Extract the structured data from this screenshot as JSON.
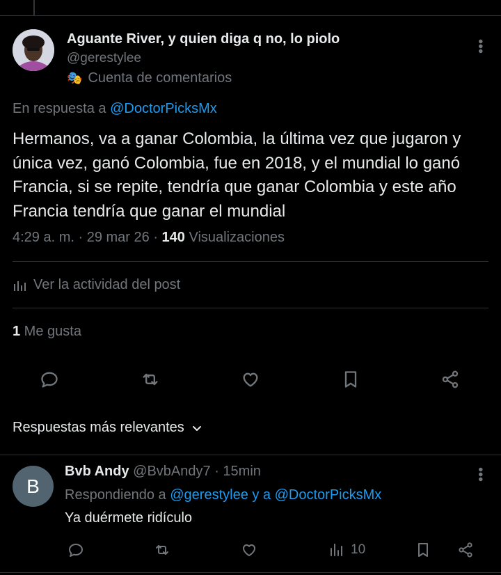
{
  "post": {
    "author_name": "Aguante River, y quien diga q no, lo piolo",
    "handle": "@gerestylee",
    "account_label": "Cuenta de comentarios",
    "account_icon": "theater-masks-icon",
    "reply_prefix": "En respuesta a",
    "reply_target": "@DoctorPicksMx",
    "text": "Hermanos, va a ganar Colombia, la última vez que jugaron y única vez, ganó Colombia, fue en 2018, y el mundial lo ganó Francia, si se repite, tendría que ganar Colombia y este año Francia tendría que ganar el mundial",
    "time": "4:29 a. m. · 29 mar 26 · ",
    "views_count": "140",
    "views_label": " Visualizaciones",
    "activity_label": "Ver la actividad del post",
    "likes_count": "1",
    "likes_label": " Me gusta"
  },
  "sort": {
    "label": "Respuestas más relevantes"
  },
  "reply": {
    "avatar_letter": "B",
    "author_name": "Bvb Andy",
    "handle_time": " @BvbAndy7 · 15min",
    "responding_prefix": "Respondiendo a ",
    "responding_to_1": "@gerestylee",
    "responding_join": " y a ",
    "responding_to_2": "@DoctorPicksMx",
    "text": "Ya duérmete ridículo",
    "views": "10"
  },
  "colors": {
    "background": "#000000",
    "text": "#e7e9ea",
    "muted": "#71767b",
    "link": "#1d9bf0",
    "divider": "#2f3336"
  }
}
